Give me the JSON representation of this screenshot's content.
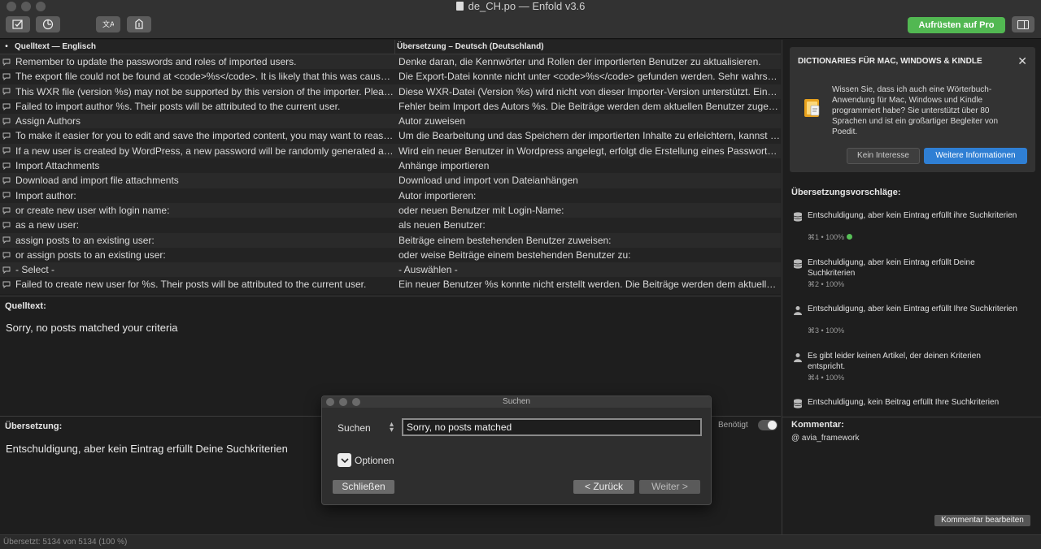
{
  "window": {
    "title": "de_CH.po — Enfold v3.6",
    "upgrade_label": "Aufrüsten auf Pro"
  },
  "toolbar": {
    "buttons": [
      "validate-icon",
      "progress-icon",
      "translate-icon",
      "upload-icon"
    ]
  },
  "table": {
    "header_source": "Quelltext — Englisch",
    "header_translation": "Übersetzung – Deutsch (Deutschland)",
    "rows": [
      {
        "source": "Remember to update the passwords and roles of imported users.",
        "translation": "Denke daran, die Kennwörter und Rollen der importierten Benutzer zu aktualisieren."
      },
      {
        "source": "The export file could not be found at <code>%s</code>. It is likely that this was caused…",
        "translation": "Die Export-Datei konnte nicht unter <code>%s</code> gefunden werden. Sehr wahrsch…"
      },
      {
        "source": "This WXR file (version %s) may not be supported by this version of the importer. Please…",
        "translation": "Diese WXR-Datei (Version %s) wird nicht von dieser Importer-Version unterstützt. Eine…"
      },
      {
        "source": "Failed to import author %s. Their posts will be attributed to the current user.",
        "translation": "Fehler beim Import des Autors %s. Die Beiträge werden dem aktuellen Benutzer zugesc…"
      },
      {
        "source": "Assign Authors",
        "translation": "Autor zuweisen"
      },
      {
        "source": "To make it easier for you to edit and save the imported content, you may want to reassi…",
        "translation": "Um die Bearbeitung und das Speichern der importierten Inhalte zu erleichtern, kannst D…"
      },
      {
        "source": "If a new user is created by WordPress, a new password will be randomly generated and…",
        "translation": "Wird ein neuer Benutzer in Wordpress angelegt, erfolgt die Erstellung eines Passwortes…"
      },
      {
        "source": "Import Attachments",
        "translation": "Anhänge importieren"
      },
      {
        "source": "Download and import file attachments",
        "translation": "Download und import von Dateianhängen"
      },
      {
        "source": "Import author:",
        "translation": "Autor importieren:"
      },
      {
        "source": "or create new user with login name:",
        "translation": "oder neuen Benutzer mit Login-Name:"
      },
      {
        "source": "as a new user:",
        "translation": "als neuen Benutzer:"
      },
      {
        "source": "assign posts to an existing user:",
        "translation": "Beiträge einem bestehenden Benutzer zuweisen:"
      },
      {
        "source": "or assign posts to an existing user:",
        "translation": "oder weise Beiträge einem bestehenden Benutzer zu:"
      },
      {
        "source": "- Select -",
        "translation": "- Auswählen -"
      },
      {
        "source": "Failed to create new user for %s. Their posts will be attributed to the current user.",
        "translation": "Ein neuer Benutzer %s konnte nicht erstellt werden. Die Beiträge werden dem aktuellen…"
      }
    ]
  },
  "source_panel": {
    "label": "Quelltext:",
    "text": "Sorry, no posts matched your criteria"
  },
  "translation_panel": {
    "label": "Übersetzung:",
    "text": "Entschuldigung, aber kein Eintrag erfüllt Deine Suchkriterien",
    "needs_work_label": "Benötigt"
  },
  "status": {
    "text": "Übersetzt: 5134 von 5134 (100 %)"
  },
  "sidebar": {
    "promo": {
      "title": "DICTIONARIES FÜR MAC, WINDOWS & KINDLE",
      "close": "✕",
      "text": "Wissen Sie, dass ich auch eine Wörterbuch-Anwendung für Mac, Windows und Kindle programmiert habe? Sie unterstützt über 80 Sprachen und ist ein großartiger Begleiter von Poedit.",
      "no_label": "Kein Interesse",
      "more_label": "Weitere Informationen"
    },
    "suggestions_title": "Übersetzungsvorschläge:",
    "suggestions": [
      {
        "text": "Entschuldigung, aber kein Eintrag erfüllt ihre Suchkriterien",
        "meta": "⌘1 • 100%",
        "icon": "database-icon",
        "exact": true
      },
      {
        "text": "Entschuldigung, aber kein Eintrag erfüllt Deine Suchkriterien",
        "meta": "⌘2 • 100%",
        "icon": "database-icon",
        "exact": false
      },
      {
        "text": "Entschuldigung, aber kein Eintrag erfüllt Ihre Suchkriterien",
        "meta": "⌘3 • 100%",
        "icon": "person-icon",
        "exact": false
      },
      {
        "text": "Es gibt leider keinen Artikel, der deinen Kriterien entspricht.",
        "meta": "⌘4 • 100%",
        "icon": "person-icon",
        "exact": false
      },
      {
        "text": "Entschuldigung, kein Beitrag erfüllt Ihre Suchkriterien",
        "meta": "",
        "icon": "database-icon",
        "exact": false
      }
    ],
    "comment_title": "Kommentar:",
    "comment_text": "@ avia_framework",
    "comment_edit_label": "Kommentar bearbeiten"
  },
  "dialog": {
    "title": "Suchen",
    "search_label": "Suchen",
    "search_value": "Sorry, no posts matched",
    "options_label": "Optionen",
    "close_label": "Schließen",
    "back_label": "< Zurück",
    "next_label": "Weiter >"
  },
  "colors": {
    "accent_green": "#52b852",
    "accent_blue": "#2f7fd4",
    "background": "#1e1e1e"
  }
}
